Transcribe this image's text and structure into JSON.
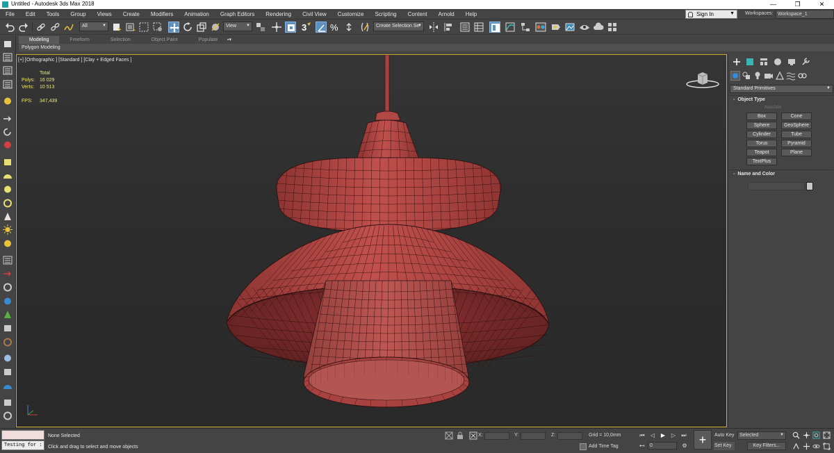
{
  "window": {
    "title": "Untitled - Autodesk 3ds Max 2018",
    "minimize": "—",
    "restore": "❐",
    "close": "✕"
  },
  "menu": [
    "File",
    "Edit",
    "Tools",
    "Group",
    "Views",
    "Create",
    "Modifiers",
    "Animation",
    "Graph Editors",
    "Rendering",
    "Civil View",
    "Customize",
    "Scripting",
    "Content",
    "Arnold",
    "Help"
  ],
  "account": {
    "sign_in": "Sign In"
  },
  "workspace": {
    "label": "Workspaces:",
    "value": "Workspace_1"
  },
  "toolbar": {
    "selection_filter": "All",
    "ref_coord": "View",
    "snap_label": "3",
    "named_selection": "Create Selection Se"
  },
  "ribbon": {
    "tabs": [
      "Modeling",
      "Freeform",
      "Selection",
      "Object Paint",
      "Populate"
    ],
    "active_tab": "Modeling",
    "sub_label": "Polygon Modeling"
  },
  "viewport": {
    "label": "[+] [Orthographic ] [Standard ] [Clay + Edged Faces ]",
    "stats": {
      "total_label": "Total",
      "polys_label": "Polys:",
      "polys": "16 029",
      "verts_label": "Verts:",
      "verts": "10 513",
      "fps_label": "FPS:",
      "fps": "347,439"
    },
    "model_color": "#a84240",
    "border_color": "#c9aa2c"
  },
  "command_panel": {
    "category": "Standard Primitives",
    "object_type_title": "Object Type",
    "autogrid": "AutoGrid",
    "buttons": [
      "Box",
      "Cone",
      "Sphere",
      "GeoSphere",
      "Cylinder",
      "Tube",
      "Torus",
      "Pyramid",
      "Teapot",
      "Plane",
      "TextPlus"
    ],
    "name_color_title": "Name and Color"
  },
  "status": {
    "maxscript_input": "Testing for :",
    "selection": "None Selected",
    "prompt": "Click and drag to select and move objects",
    "x_label": "X:",
    "y_label": "Y:",
    "z_label": "Z:",
    "grid": "Grid = 10,0mm",
    "add_time_tag": "Add Time Tag",
    "frame": "0",
    "auto_key": "Auto Key",
    "set_key": "Set Key",
    "key_mode": "Selected",
    "key_filters": "Key Filters..."
  }
}
